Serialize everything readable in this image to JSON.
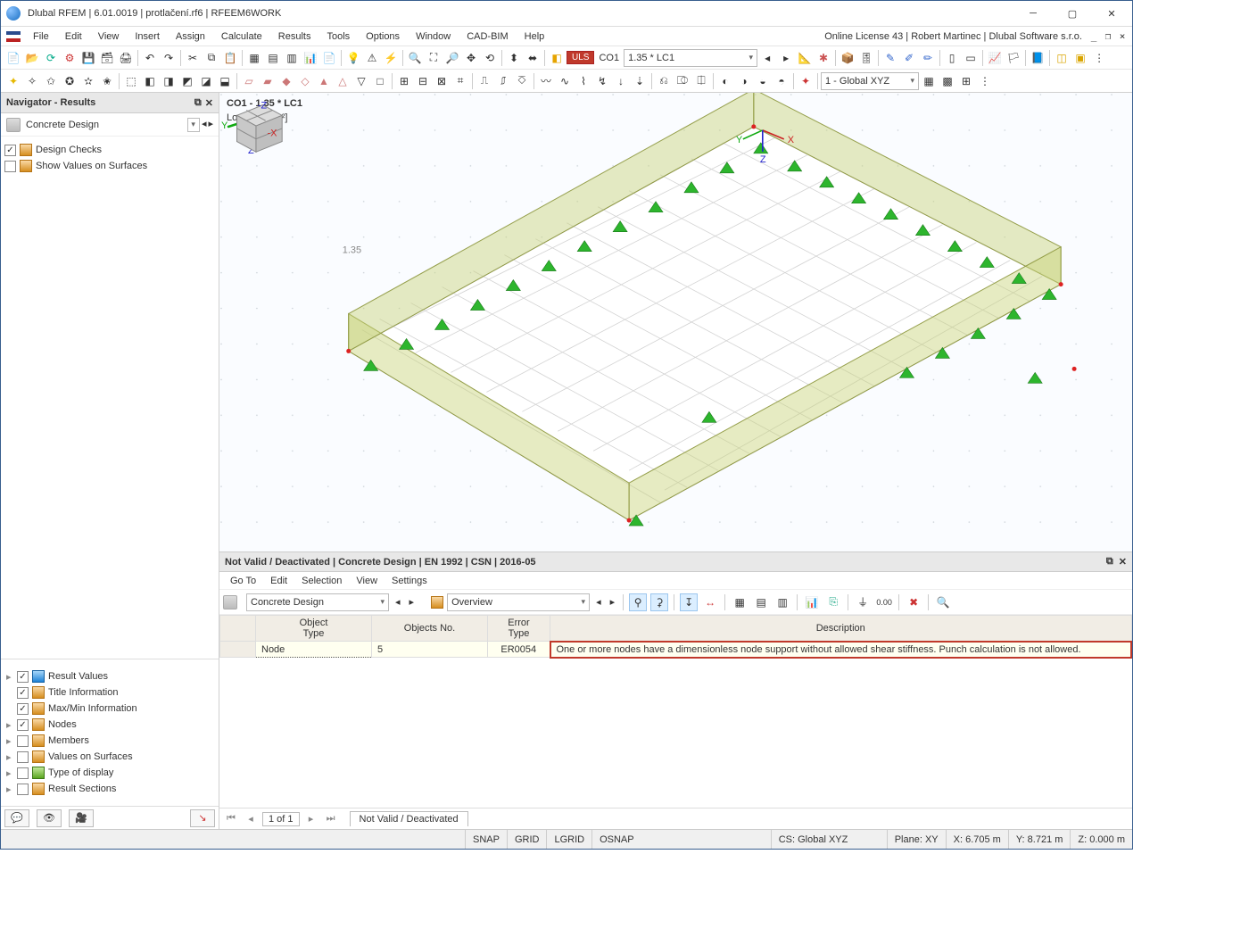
{
  "title_bar": "Dlubal RFEM | 6.01.0019 | protlačení.rf6 | RFEEM6WORK",
  "menubar": {
    "items": [
      "File",
      "Edit",
      "View",
      "Insert",
      "Assign",
      "Calculate",
      "Results",
      "Tools",
      "Options",
      "Window",
      "CAD-BIM",
      "Help"
    ],
    "right": "Online License 43 | Robert Martinec | Dlubal Software s.r.o."
  },
  "toolbar1": {
    "uls": "ULS",
    "co_code": "CO1",
    "co_label": "1.35 * LC1",
    "cs_label": "1 - Global XYZ"
  },
  "navigator": {
    "title": "Navigator - Results",
    "section": "Concrete Design",
    "top_items": [
      {
        "checked": true,
        "label": "Design Checks"
      },
      {
        "checked": false,
        "label": "Show Values on Surfaces"
      }
    ],
    "bottom_items": [
      {
        "checked": true,
        "label": "Result Values"
      },
      {
        "checked": true,
        "label": "Title Information"
      },
      {
        "checked": true,
        "label": "Max/Min Information"
      },
      {
        "checked": true,
        "label": "Nodes"
      },
      {
        "checked": false,
        "label": "Members"
      },
      {
        "checked": false,
        "label": "Values on Surfaces"
      },
      {
        "checked": false,
        "label": "Type of display"
      },
      {
        "checked": false,
        "label": "Result Sections"
      }
    ]
  },
  "viewport": {
    "label": "CO1 - 1.35 * LC1",
    "units": "Loads [kN/m²]",
    "load_value": "1.35",
    "ax": {
      "x": "X",
      "y": "Y",
      "z": "Z"
    }
  },
  "results_panel": {
    "title": "Not Valid / Deactivated | Concrete Design | EN 1992 | CSN | 2016-05",
    "menu": [
      "Go To",
      "Edit",
      "Selection",
      "View",
      "Settings"
    ],
    "combo1": "Concrete Design",
    "combo2": "Overview",
    "headers": [
      "Object\nType",
      "Objects No.",
      "Error\nType",
      "Description"
    ],
    "row": {
      "obj": "Node",
      "no": "5",
      "err": "ER0054",
      "desc": "One or more nodes have a dimensionless node support without allowed shear stiffness. Punch calculation is not allowed."
    },
    "pager": {
      "pos": "1 of 1",
      "tab": "Not Valid / Deactivated"
    }
  },
  "statusbar": {
    "snap": [
      "SNAP",
      "GRID",
      "LGRID",
      "OSNAP"
    ],
    "cs": "CS: Global XYZ",
    "plane": "Plane: XY",
    "x": "X: 6.705 m",
    "y": "Y: 8.721 m",
    "z": "Z: 0.000 m"
  }
}
